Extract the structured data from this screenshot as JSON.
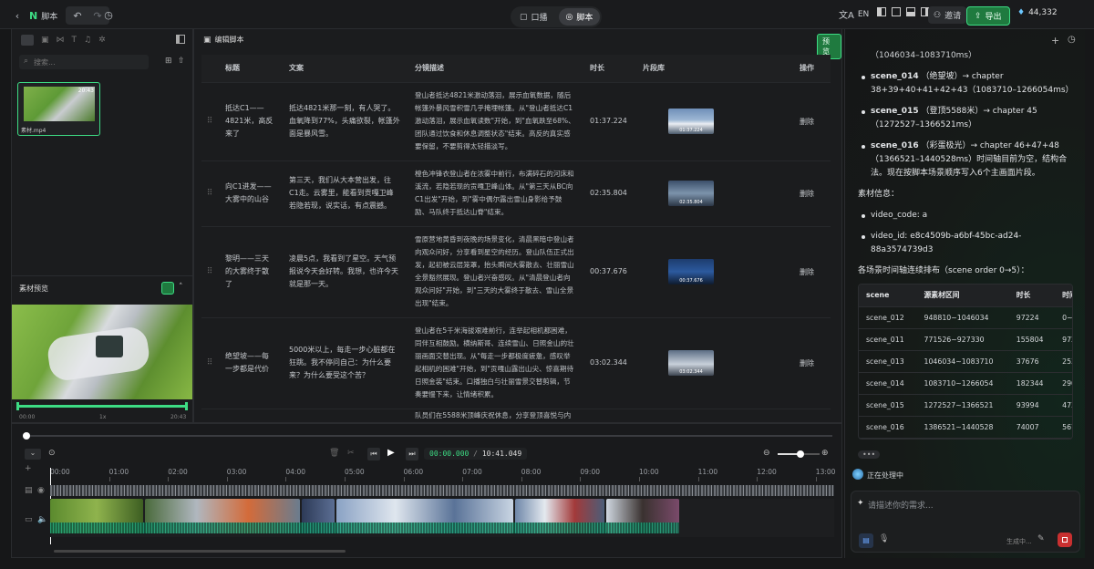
{
  "topbar": {
    "back_icon": "chevron-left-icon",
    "title": "脚本",
    "tabs": [
      "口播",
      "脚本"
    ],
    "lang": "EN",
    "invite": "邀请",
    "export": "导出",
    "credits": "44,332"
  },
  "left": {
    "search_placeholder": "搜索...",
    "clip_name": "素材.mp4",
    "clip_duration": "20:43",
    "preview_label": "素材预览",
    "time_start": "00:00",
    "speed": "1x",
    "time_end": "20:43"
  },
  "editor": {
    "title": "编辑脚本",
    "preview_button": "预览",
    "headers": [
      "标题",
      "文案",
      "分镜描述",
      "时长",
      "片段库",
      "操作"
    ],
    "rows": [
      {
        "title": "抵达C1——4821米，高反来了",
        "copy": "抵达4821米那一刻，有人哭了。血氧降到77%，头痛欲裂，帐篷外面是暴风雪。",
        "desc": "登山者抵达4821米激动落泪，展示血氧数据，随后帐篷外暴风雪积雪几乎掩埋帐篷。从\"登山者抵达C1激动落泪，展示血氧读数\"开始，到\"血氧跌至68%、团队通过饮食和休息调整状态\"结束。高反的真实感要保留，不要剪得太轻描淡写。",
        "dur": "01:37.224",
        "thumb_time": "01:37.224",
        "op": "删除"
      },
      {
        "title": "向C1进发——大雾中的山谷",
        "copy": "第三天，我们从大本营出发，往C1走。云雾里，能看到贡嘎卫峰若隐若现，说实话，有点震撼。",
        "desc": "橙色冲锋衣登山者在浓雾中前行，布满碎石的河床和溪流，若隐若现的贡嘎卫峰山体。从\"第三天从BC向C1出发\"开始，到\"雾中偶尔露出雪山身影给予鼓励、马队终于抵达山脊\"结束。",
        "dur": "02:35.804",
        "thumb_time": "02:35.804",
        "op": "删除"
      },
      {
        "title": "黎明——三天的大雾终于散了",
        "copy": "凌晨5点，我看到了星空。天气预报说今天会好转。我想，也许今天就是那一天。",
        "desc": "雪原营地黄昏到夜晚的场景变化，清晨黑暗中登山者向观众问好，分享看到星空的经历。登山队伍正式出发，起初被云层笼罩，抬头瞬间大雾散去、壮丽雪山全景豁然展现。登山者兴奋感叹。从\"清晨登山者向观众问好\"开始，到\"三天的大雾终于散去、雪山全景出现\"结束。",
        "dur": "00:37.676",
        "thumb_time": "00:37.676",
        "op": "删除"
      },
      {
        "title": "绝望坡——每一步都是代价",
        "copy": "5000米以上，每走一步心脏都在狂跳。我不停问自己：为什么要来？为什么要受这个苦？",
        "desc": "登山者在5千米海拔艰难前行，连举起相机都困难，同伴互相鼓励。横纳斯哥、连续雪山、日照金山的壮丽画面交替出现。从\"每走一步都极度疲惫，感叹举起相机的困难\"开始，到\"贡嘎山露出山尖、惊喜期待日照金装\"结束。口播独白与壮丽雪景交替剪辑，节奏要慢下来，让情绪积累。",
        "dur": "03:02.344",
        "thumb_time": "03:02.344",
        "op": "删除"
      },
      {
        "title": "",
        "copy": "",
        "desc": "队员们在5588米顶峰庆祝休息，分享登顶喜悦与内",
        "dur": "",
        "thumb_time": "",
        "op": ""
      }
    ]
  },
  "timeline": {
    "current": "00:00.000",
    "total": "10:41.049",
    "ruler": [
      "00:00",
      "01:00",
      "02:00",
      "03:00",
      "04:00",
      "05:00",
      "06:00",
      "07:00",
      "08:00",
      "09:00",
      "10:00",
      "11:00",
      "12:00",
      "13:00"
    ],
    "zoom_level": 0.55
  },
  "chat": {
    "frag_top": "（1046034–1083710ms）",
    "items": [
      {
        "scene": "scene_014",
        "rest": "（绝望坡）→ chapter 38+39+40+41+42+43（1083710–1266054ms）"
      },
      {
        "scene": "scene_015",
        "rest": "（登顶5588米）→ chapter 45（1272527–1366521ms）"
      },
      {
        "scene": "scene_016",
        "rest": "（彩蛋极光）→ chapter 46+47+48（1366521–1440528ms）时间轴目前为空，结构合法。现在按脚本场景顺序写入6个主画面片段。"
      }
    ],
    "info_title": "素材信息：",
    "info_items": [
      "video_code: a",
      "video_id: e8c4509b-a6bf-45bc-ad24-88a3574739d3"
    ],
    "order_title": "各场景时间轴连续排布（scene order 0→5）：",
    "table_headers": [
      "scene",
      "源素材区间",
      "时长",
      "时间轴位置"
    ],
    "table_rows": [
      [
        "scene_012",
        "948810~1046034",
        "97224",
        "0~97224"
      ],
      [
        "scene_011",
        "771526~927330",
        "155804",
        "97224~25302"
      ],
      [
        "scene_013",
        "1046034~1083710",
        "37676",
        "253028~29070"
      ],
      [
        "scene_014",
        "1083710~1266054",
        "182344",
        "290704~47304"
      ],
      [
        "scene_015",
        "1272527~1366521",
        "93994",
        "473048~56704"
      ],
      [
        "scene_016",
        "1386521~1440528",
        "74007",
        "567042~64104"
      ]
    ],
    "processing": "正在处理中",
    "input_placeholder": "请描述你的需求...",
    "generating": "生成中..."
  }
}
